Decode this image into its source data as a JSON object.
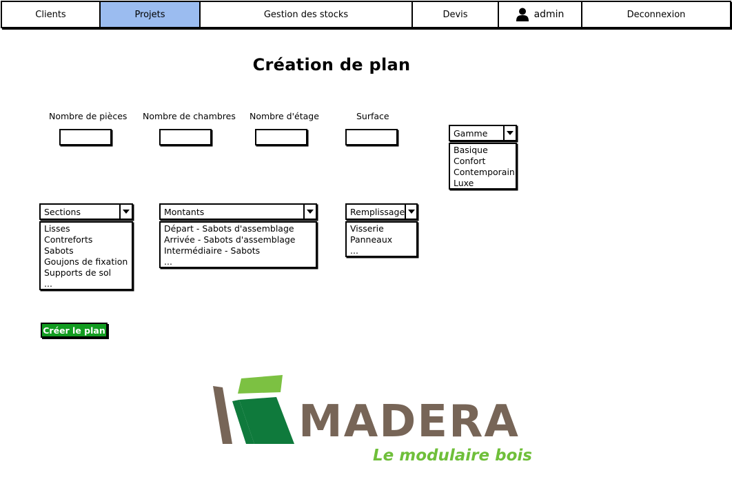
{
  "nav": {
    "items": [
      {
        "label": "Clients",
        "active": false
      },
      {
        "label": "Projets",
        "active": true
      },
      {
        "label": "Gestion des stocks",
        "active": false
      },
      {
        "label": "Devis",
        "active": false
      }
    ],
    "user_label": "admin",
    "user_icon": "user-icon",
    "logout_label": "Deconnexion",
    "active_color": "#9bbcf0"
  },
  "page": {
    "title": "Création de plan"
  },
  "fields": {
    "pieces_label": "Nombre de pièces",
    "chambres_label": "Nombre de chambres",
    "etage_label": "Nombre d'étage",
    "surface_label": "Surface",
    "pieces_value": "",
    "chambres_value": "",
    "etage_value": "",
    "surface_value": ""
  },
  "gamme": {
    "label": "Gamme",
    "options": [
      "Basique",
      "Confort",
      "Contemporain",
      "Luxe"
    ]
  },
  "sections": {
    "label": "Sections",
    "options": [
      "Lisses",
      "Contreforts",
      "Sabots",
      "Goujons de fixation",
      "Supports de sol",
      "..."
    ]
  },
  "montants": {
    "label": "Montants",
    "options": [
      "Départ - Sabots d'assemblage",
      "Arrivée - Sabots d'assemblage",
      "Intermédiaire - Sabots",
      "..."
    ]
  },
  "remplissage": {
    "label": "Remplissage",
    "options": [
      "Visserie",
      "Panneaux",
      "..."
    ]
  },
  "actions": {
    "create_label": "Créer le plan",
    "create_color": "#129c20"
  },
  "logo": {
    "name": "MADERA",
    "tagline": "Le modulaire bois",
    "colors": {
      "brown": "#776557",
      "dark_green": "#0f7a3c",
      "light_green": "#7cc142"
    }
  }
}
